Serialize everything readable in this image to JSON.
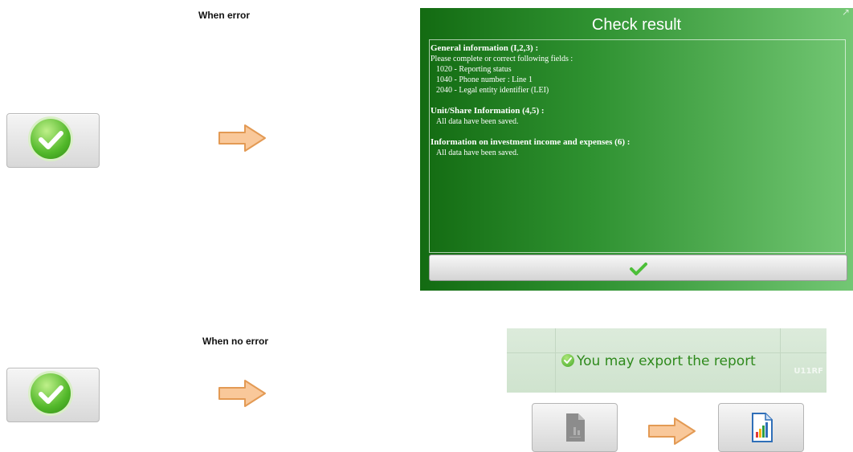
{
  "labels": {
    "when_error": "When error",
    "when_no_error": "When no error"
  },
  "dialog": {
    "title": "Check result",
    "sections": [
      {
        "title": "General information (I,2,3) :",
        "intro": "Please complete or correct following fields :",
        "items": [
          "1020 - Reporting status",
          "1040 - Phone number : Line 1",
          "2040 - Legal entity identifier (LEI)"
        ]
      },
      {
        "title": "Unit/Share Information (4,5) :",
        "message": "All data have been saved."
      },
      {
        "title": "Information on investment income and expenses (6) :",
        "message": "All data have been saved."
      }
    ]
  },
  "export_notice": {
    "message": "You may export the report",
    "background_text": "U11RF"
  },
  "icons": {
    "check_button": "check-circle-icon",
    "arrow": "arrow-right-icon",
    "ok": "checkmark-icon",
    "report_disabled": "report-disabled-icon",
    "report_enabled": "report-chart-icon"
  },
  "colors": {
    "dialog_dark": "#136b12",
    "dialog_light": "#73c774",
    "success_text": "#2f8a1d",
    "arrow_fill": "#f9c89a",
    "arrow_stroke": "#e39a54"
  }
}
